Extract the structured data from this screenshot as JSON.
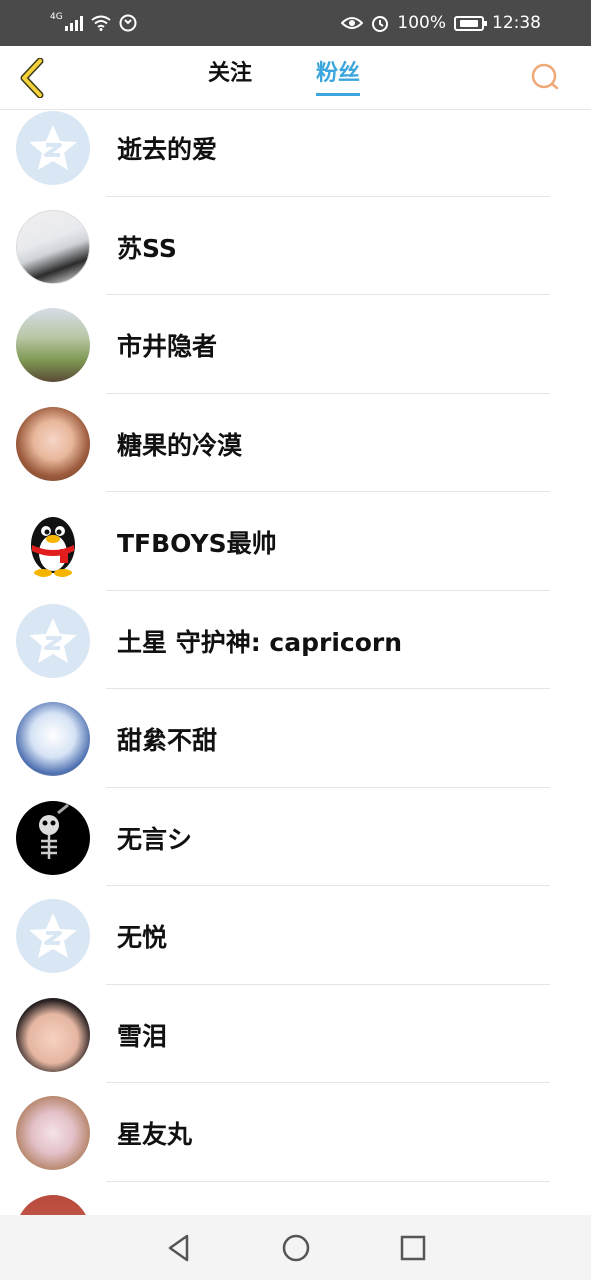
{
  "status_bar": {
    "network": "4G",
    "battery": "100%",
    "time": "12:38"
  },
  "header": {
    "tabs": [
      {
        "label": "关注",
        "active": false
      },
      {
        "label": "粉丝",
        "active": true
      }
    ],
    "accent_color": "#3aa6dd",
    "back_icon": "chevron-left-icon",
    "search_icon": "search-icon"
  },
  "fans": [
    {
      "name": "逝去的爱",
      "avatar": "default-qzone-avatar"
    },
    {
      "name": "苏SS",
      "avatar": "anime-avatar"
    },
    {
      "name": "市井隐者",
      "avatar": "photo-avatar"
    },
    {
      "name": "糖果的冷漠",
      "avatar": "anime-avatar"
    },
    {
      "name": "TFBOYS最帅",
      "avatar": "qq-penguin-avatar"
    },
    {
      "name": "土星 守护神: capricorn",
      "avatar": "default-qzone-avatar"
    },
    {
      "name": "甜絫不甜",
      "avatar": "anime-avatar"
    },
    {
      "name": "无言シ",
      "avatar": "skeleton-avatar"
    },
    {
      "name": "无悦",
      "avatar": "default-qzone-avatar"
    },
    {
      "name": "雪泪",
      "avatar": "photo-avatar"
    },
    {
      "name": "星友丸",
      "avatar": "anime-avatar"
    }
  ],
  "nav_bar": {
    "back_icon": "triangle-back-icon",
    "home_icon": "circle-home-icon",
    "recents_icon": "square-recents-icon"
  }
}
